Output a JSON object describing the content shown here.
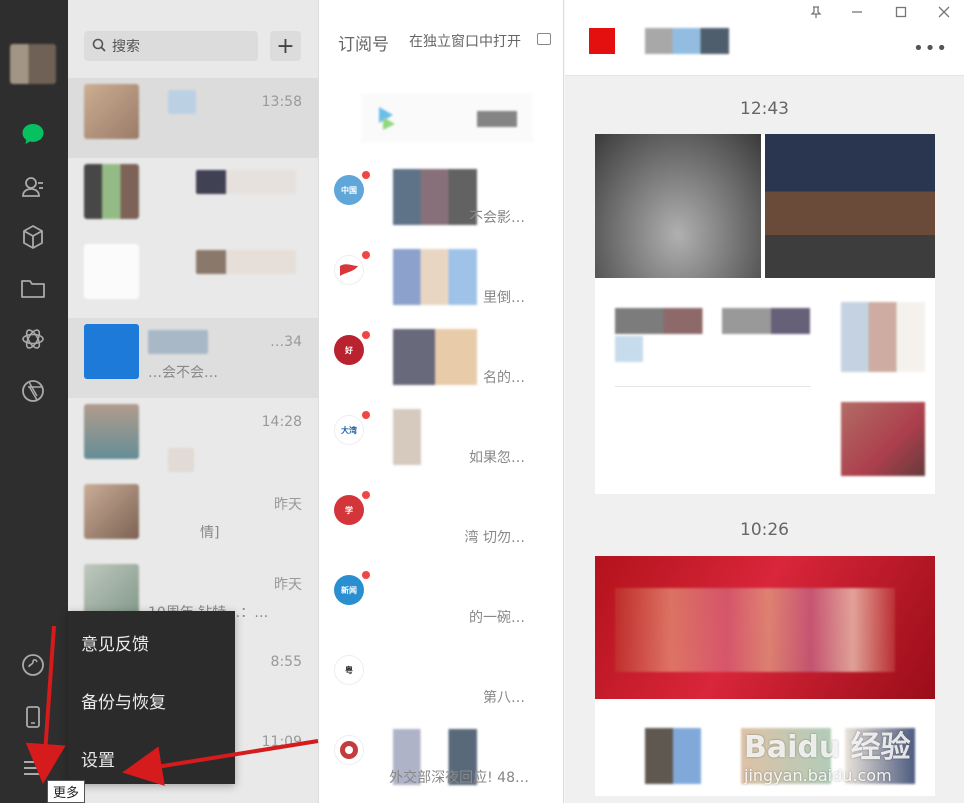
{
  "left_rail": {
    "icons": [
      "avatar",
      "chat-icon",
      "contacts-icon",
      "cube-icon",
      "folder-icon",
      "moments-icon",
      "aperture-icon",
      "mini-program-icon",
      "phone-icon",
      "menu-icon"
    ],
    "accent": "#07c160"
  },
  "search": {
    "placeholder": "搜索"
  },
  "add_button": {
    "label": "+"
  },
  "chats": [
    {
      "time": "13:58",
      "preview": ""
    },
    {
      "time": "",
      "preview": ""
    },
    {
      "time": "",
      "preview": ""
    },
    {
      "time": "…34",
      "preview": "…会不会…"
    },
    {
      "time": "14:28",
      "preview": ""
    },
    {
      "time": "昨天",
      "preview": "情]"
    },
    {
      "time": "昨天",
      "preview": "10周年 钻特…：…"
    },
    {
      "time": "8:55",
      "preview": ""
    },
    {
      "time": "11:09",
      "preview": ""
    }
  ],
  "subscriptions": {
    "title": "订阅号",
    "open_window": "在独立窗口中打开",
    "items": [
      {
        "snippet": "不会影…"
      },
      {
        "snippet": "里倒…"
      },
      {
        "snippet": "名的…"
      },
      {
        "snippet": "如果忽…"
      },
      {
        "snippet": "湾 切勿…"
      },
      {
        "snippet": "的一碗…"
      },
      {
        "snippet": "第八…"
      },
      {
        "snippet": "外交部深夜回应! 48…"
      }
    ]
  },
  "content": {
    "times": [
      "12:43",
      "10:26"
    ],
    "more": "•••"
  },
  "menu": {
    "items": [
      "意见反馈",
      "备份与恢复",
      "设置"
    ],
    "tooltip": "更多"
  },
  "watermark": {
    "text": "Baidu 经验",
    "sub": "jingyan.baidu.com"
  }
}
